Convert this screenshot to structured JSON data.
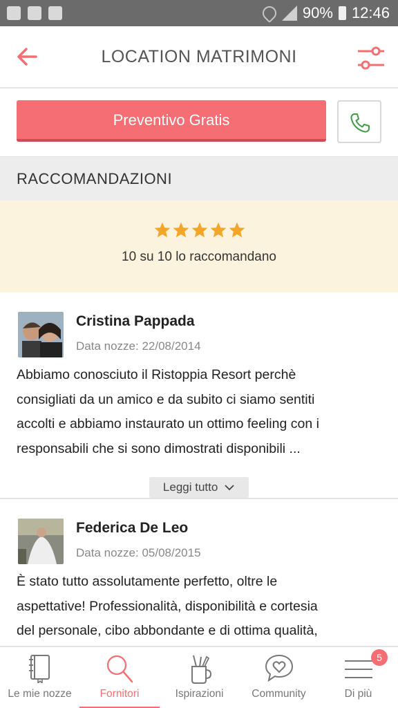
{
  "status_bar": {
    "battery": "90%",
    "time": "12:46"
  },
  "appbar": {
    "title": "LOCATION MATRIMONI"
  },
  "actions": {
    "quote_label": "Preventivo Gratis"
  },
  "section": {
    "title": "RACCOMANDAZIONI"
  },
  "recommendation": {
    "stars": 5,
    "summary": "10 su 10 lo raccomandano"
  },
  "reviews": [
    {
      "name": "Cristina Pappada",
      "date": "Data nozze: 22/08/2014",
      "lines": [
        "Abbiamo conosciuto il Ristoppia Resort perchè",
        "consigliati da un amico e da subito ci siamo sentiti",
        "accolti e abbiamo instaurato un ottimo feeling con i",
        "responsabili che si sono dimostrati disponibili ..."
      ],
      "read_more": "Leggi tutto"
    },
    {
      "name": "Federica De Leo",
      "date": "Data nozze: 05/08/2015",
      "lines": [
        "È stato tutto assolutamente perfetto, oltre le",
        "aspettative! Professionalità, disponibilità e cortesia",
        "del personale, cibo abbondante e di ottima qualità,"
      ]
    }
  ],
  "nav": {
    "items": [
      {
        "label": "Le mie nozze",
        "icon": "notebook-icon"
      },
      {
        "label": "Fornitori",
        "icon": "search-icon",
        "active": true
      },
      {
        "label": "Ispirazioni",
        "icon": "brush-cup-icon"
      },
      {
        "label": "Community",
        "icon": "heart-chat-icon"
      },
      {
        "label": "Di più",
        "icon": "menu-icon",
        "badge": "5"
      }
    ]
  },
  "colors": {
    "accent": "#f46e73",
    "summary_bg": "#fcf3de",
    "section_bg": "#ededed",
    "call_icon": "#3f9b48"
  }
}
